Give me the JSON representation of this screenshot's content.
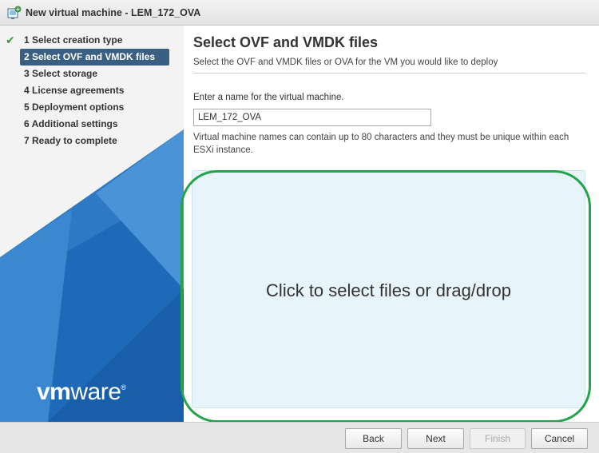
{
  "window": {
    "title": "New virtual machine - LEM_172_OVA",
    "icon": "new-vm-icon"
  },
  "sidebar": {
    "steps": [
      {
        "label": "1 Select creation type",
        "state": "completed"
      },
      {
        "label": "2 Select OVF and VMDK files",
        "state": "active"
      },
      {
        "label": "3 Select storage",
        "state": "pending"
      },
      {
        "label": "4 License agreements",
        "state": "pending"
      },
      {
        "label": "5 Deployment options",
        "state": "pending"
      },
      {
        "label": "6 Additional settings",
        "state": "pending"
      },
      {
        "label": "7 Ready to complete",
        "state": "pending"
      }
    ],
    "logo": {
      "vm": "vm",
      "ware": "ware",
      "registered": "®"
    }
  },
  "main": {
    "title": "Select OVF and VMDK files",
    "subtitle": "Select the OVF and VMDK files or OVA for the VM you would like to deploy",
    "name_label": "Enter a name for the virtual machine.",
    "name_value": "LEM_172_OVA",
    "help_text": "Virtual machine names can contain up to 80 characters and they must be unique within each ESXi instance.",
    "dropzone_text": "Click to select files or drag/drop"
  },
  "footer": {
    "back": "Back",
    "next": "Next",
    "finish": "Finish",
    "cancel": "Cancel"
  },
  "colors": {
    "active_step": "#3b5f82",
    "check": "#3d9a3d",
    "dropzone": "#e8f4fc",
    "highlight": "#22a448",
    "brand_blue": "#1d6fc0"
  }
}
